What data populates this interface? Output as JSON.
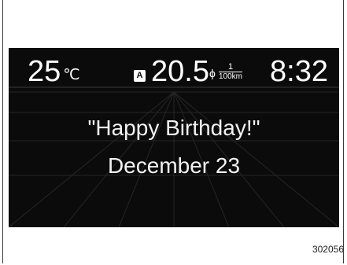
{
  "status_bar": {
    "temperature": "25",
    "temperature_unit": "℃",
    "mode_badge": "A",
    "fuel_economy": "20.5",
    "fuel_unit_symbol": "ϕ",
    "fuel_unit_numerator": "1",
    "fuel_unit_denominator": "100km",
    "clock": "8:32"
  },
  "message": {
    "line1": "\"Happy Birthday!\"",
    "line2": "December 23"
  },
  "figure_number": "302056",
  "colors": {
    "screen_background": "#0b0b0b",
    "text": "#ffffff"
  }
}
